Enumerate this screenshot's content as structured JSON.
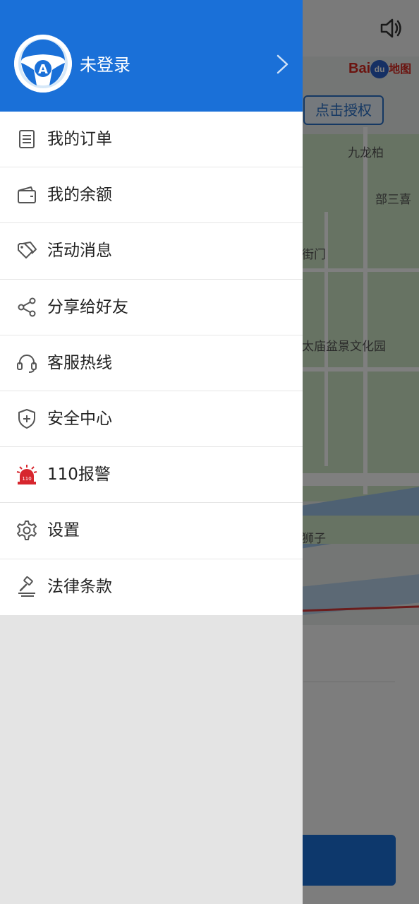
{
  "map": {
    "authorize_button": "点击授权",
    "logo_text": "Bai",
    "logo_paw": "du",
    "logo_suffix": "地图",
    "labels": [
      "九龙柏",
      "部三喜",
      "街门",
      "太庙盆景文化园",
      "狮子"
    ],
    "speaker_icon": "speaker-icon"
  },
  "drawer": {
    "header": {
      "avatar_icon": "steering-wheel-logo",
      "login_label": "未登录",
      "chevron_icon": "chevron-right-icon"
    },
    "menu": [
      {
        "label": "我的订单",
        "icon": "order-list-icon"
      },
      {
        "label": "我的余额",
        "icon": "wallet-icon"
      },
      {
        "label": "活动消息",
        "icon": "tag-icon"
      },
      {
        "label": "分享给好友",
        "icon": "share-icon"
      },
      {
        "label": "客服热线",
        "icon": "headset-icon"
      },
      {
        "label": "安全中心",
        "icon": "shield-icon"
      },
      {
        "label": "110报警",
        "icon": "police-siren-icon",
        "icon_text": "110"
      },
      {
        "label": "设置",
        "icon": "gear-icon"
      },
      {
        "label": "法律条款",
        "icon": "gavel-icon"
      }
    ]
  },
  "colors": {
    "primary": "#1a70d8",
    "alarm": "#d7262e",
    "icon_gray": "#555555"
  }
}
